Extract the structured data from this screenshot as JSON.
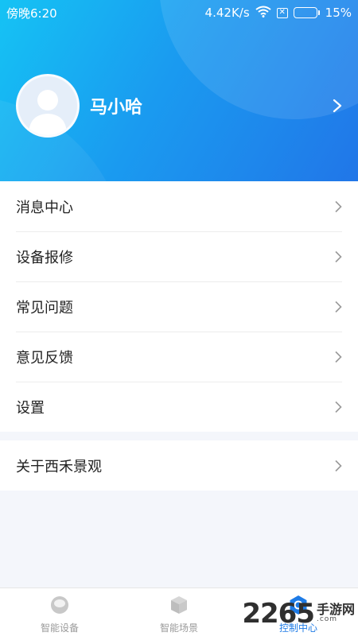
{
  "status_bar": {
    "time": "傍晚6:20",
    "network_speed": "4.42K/s",
    "sim_glyph": "✕",
    "battery_percent": "15%",
    "battery_level": 0.15,
    "icons": [
      "wifi-icon",
      "no-sim-icon",
      "battery-icon"
    ]
  },
  "profile": {
    "username": "马小哈",
    "avatar_icon": "default-avatar-icon"
  },
  "menu": {
    "items": [
      {
        "label": "消息中心"
      },
      {
        "label": "设备报修"
      },
      {
        "label": "常见问题"
      },
      {
        "label": "意见反馈"
      },
      {
        "label": "设置"
      }
    ],
    "about": {
      "label": "关于西禾景观"
    }
  },
  "tabbar": {
    "tabs": [
      {
        "label": "智能设备",
        "icon": "device-icon",
        "active": false
      },
      {
        "label": "智能场景",
        "icon": "cube-icon",
        "active": false
      },
      {
        "label": "控制中心",
        "icon": "hexagon-icon",
        "active": true
      }
    ]
  },
  "watermark": {
    "number": "2265",
    "text": "手游网",
    "sub": ".com"
  },
  "colors": {
    "header_start": "#15c3f4",
    "header_end": "#2176e8",
    "accent": "#1e7be6",
    "background": "#f4f6fb"
  }
}
